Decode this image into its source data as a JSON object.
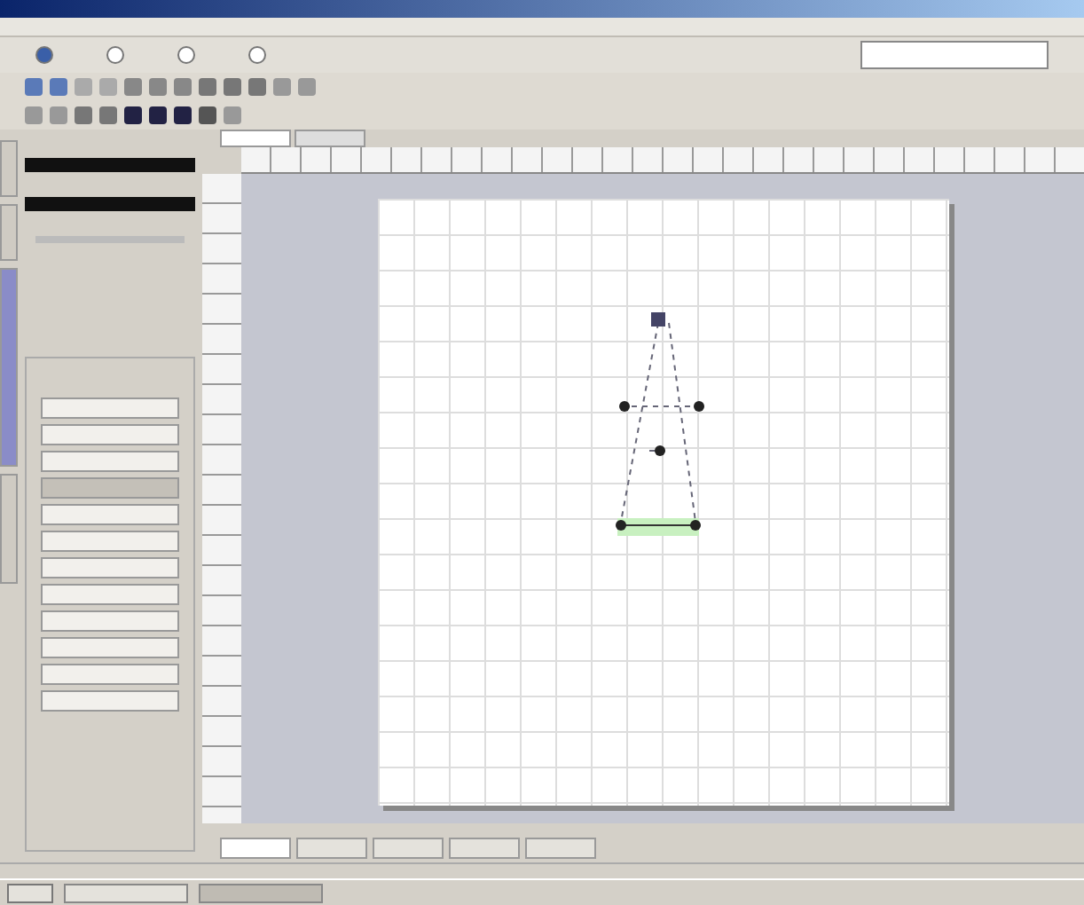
{
  "mode_options": [
    {
      "selected": true
    },
    {
      "selected": false
    },
    {
      "selected": false
    },
    {
      "selected": false
    }
  ],
  "document_tabs": [
    {
      "selected": true
    },
    {
      "selected": false
    }
  ],
  "panel_buttons": [
    {
      "selected": false
    },
    {
      "selected": false
    },
    {
      "selected": false
    },
    {
      "selected": true
    },
    {
      "selected": false
    },
    {
      "selected": false
    },
    {
      "selected": false
    },
    {
      "selected": false
    },
    {
      "selected": false
    },
    {
      "selected": false
    },
    {
      "selected": false
    },
    {
      "selected": false
    }
  ],
  "bottom_tabs": [
    {
      "selected": true
    },
    {
      "selected": false
    },
    {
      "selected": false
    },
    {
      "selected": false
    },
    {
      "selected": false
    }
  ],
  "side_tabs": [
    {
      "selected": false
    },
    {
      "selected": false
    },
    {
      "selected": true
    },
    {
      "selected": false
    }
  ]
}
